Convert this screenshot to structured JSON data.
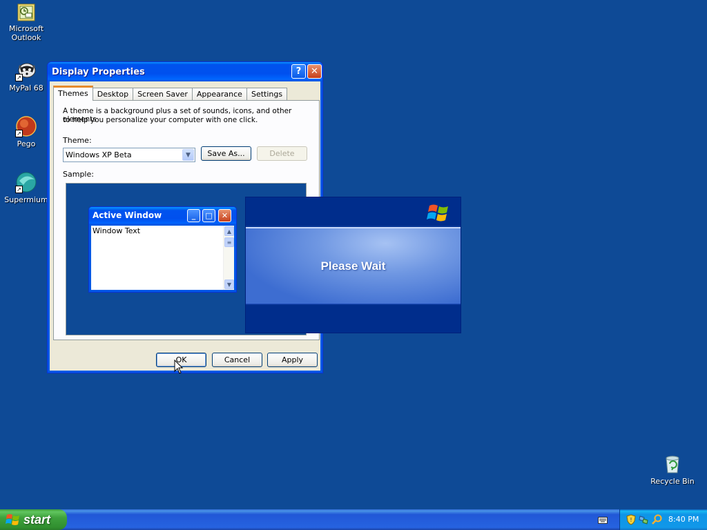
{
  "desktop": {
    "icons": [
      {
        "label_line1": "Microsoft",
        "label_line2": "Outlook",
        "icon": "outlook-icon"
      },
      {
        "label_line1": "MyPal 68",
        "label_line2": "",
        "icon": "mypal-icon"
      },
      {
        "label_line1": "Pego",
        "label_line2": "",
        "icon": "pego-icon"
      },
      {
        "label_line1": "Supermium",
        "label_line2": "",
        "icon": "supermium-icon"
      }
    ],
    "recycle_bin": {
      "label": "Recycle Bin",
      "icon": "recycle-bin-icon"
    },
    "background_color": "#0e4a96"
  },
  "dialog": {
    "title": "Display Properties",
    "help_glyph": "?",
    "close_glyph": "✕",
    "tabs": [
      {
        "label": "Themes",
        "active": true
      },
      {
        "label": "Desktop",
        "active": false
      },
      {
        "label": "Screen Saver",
        "active": false
      },
      {
        "label": "Appearance",
        "active": false
      },
      {
        "label": "Settings",
        "active": false
      }
    ],
    "description_line1": "A theme is a background plus a set of sounds, icons, and other elements",
    "description_line2": "to help you personalize your computer with one click.",
    "theme_label": "Theme:",
    "theme_value": "Windows XP Beta",
    "save_as_label": "Save As...",
    "delete_label": "Delete",
    "sample_label": "Sample:",
    "sample": {
      "window_title": "Active Window",
      "window_text": "Window Text"
    },
    "ok_label": "OK",
    "cancel_label": "Cancel",
    "apply_label": "Apply"
  },
  "please_wait": {
    "text": "Please Wait"
  },
  "taskbar": {
    "start_label": "start",
    "clock": "8:40 PM"
  },
  "colors": {
    "accent_blue": "#0058e6",
    "start_green": "#3fa23d",
    "tab_highlight": "#e68b2c"
  }
}
